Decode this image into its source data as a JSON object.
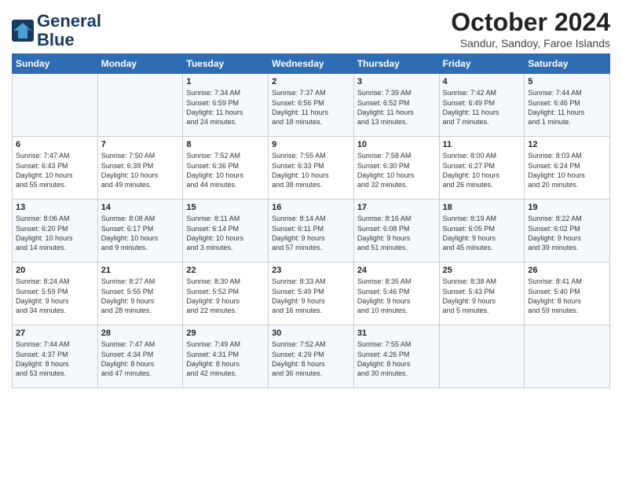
{
  "header": {
    "logo_line1": "General",
    "logo_line2": "Blue",
    "month_title": "October 2024",
    "location": "Sandur, Sandoy, Faroe Islands"
  },
  "weekdays": [
    "Sunday",
    "Monday",
    "Tuesday",
    "Wednesday",
    "Thursday",
    "Friday",
    "Saturday"
  ],
  "weeks": [
    [
      {
        "day": "",
        "text": ""
      },
      {
        "day": "",
        "text": ""
      },
      {
        "day": "1",
        "text": "Sunrise: 7:34 AM\nSunset: 6:59 PM\nDaylight: 11 hours\nand 24 minutes."
      },
      {
        "day": "2",
        "text": "Sunrise: 7:37 AM\nSunset: 6:56 PM\nDaylight: 11 hours\nand 18 minutes."
      },
      {
        "day": "3",
        "text": "Sunrise: 7:39 AM\nSunset: 6:52 PM\nDaylight: 11 hours\nand 13 minutes."
      },
      {
        "day": "4",
        "text": "Sunrise: 7:42 AM\nSunset: 6:49 PM\nDaylight: 11 hours\nand 7 minutes."
      },
      {
        "day": "5",
        "text": "Sunrise: 7:44 AM\nSunset: 6:46 PM\nDaylight: 11 hours\nand 1 minute."
      }
    ],
    [
      {
        "day": "6",
        "text": "Sunrise: 7:47 AM\nSunset: 6:43 PM\nDaylight: 10 hours\nand 55 minutes."
      },
      {
        "day": "7",
        "text": "Sunrise: 7:50 AM\nSunset: 6:39 PM\nDaylight: 10 hours\nand 49 minutes."
      },
      {
        "day": "8",
        "text": "Sunrise: 7:52 AM\nSunset: 6:36 PM\nDaylight: 10 hours\nand 44 minutes."
      },
      {
        "day": "9",
        "text": "Sunrise: 7:55 AM\nSunset: 6:33 PM\nDaylight: 10 hours\nand 38 minutes."
      },
      {
        "day": "10",
        "text": "Sunrise: 7:58 AM\nSunset: 6:30 PM\nDaylight: 10 hours\nand 32 minutes."
      },
      {
        "day": "11",
        "text": "Sunrise: 8:00 AM\nSunset: 6:27 PM\nDaylight: 10 hours\nand 26 minutes."
      },
      {
        "day": "12",
        "text": "Sunrise: 8:03 AM\nSunset: 6:24 PM\nDaylight: 10 hours\nand 20 minutes."
      }
    ],
    [
      {
        "day": "13",
        "text": "Sunrise: 8:06 AM\nSunset: 6:20 PM\nDaylight: 10 hours\nand 14 minutes."
      },
      {
        "day": "14",
        "text": "Sunrise: 8:08 AM\nSunset: 6:17 PM\nDaylight: 10 hours\nand 9 minutes."
      },
      {
        "day": "15",
        "text": "Sunrise: 8:11 AM\nSunset: 6:14 PM\nDaylight: 10 hours\nand 3 minutes."
      },
      {
        "day": "16",
        "text": "Sunrise: 8:14 AM\nSunset: 6:11 PM\nDaylight: 9 hours\nand 57 minutes."
      },
      {
        "day": "17",
        "text": "Sunrise: 8:16 AM\nSunset: 6:08 PM\nDaylight: 9 hours\nand 51 minutes."
      },
      {
        "day": "18",
        "text": "Sunrise: 8:19 AM\nSunset: 6:05 PM\nDaylight: 9 hours\nand 45 minutes."
      },
      {
        "day": "19",
        "text": "Sunrise: 8:22 AM\nSunset: 6:02 PM\nDaylight: 9 hours\nand 39 minutes."
      }
    ],
    [
      {
        "day": "20",
        "text": "Sunrise: 8:24 AM\nSunset: 5:59 PM\nDaylight: 9 hours\nand 34 minutes."
      },
      {
        "day": "21",
        "text": "Sunrise: 8:27 AM\nSunset: 5:55 PM\nDaylight: 9 hours\nand 28 minutes."
      },
      {
        "day": "22",
        "text": "Sunrise: 8:30 AM\nSunset: 5:52 PM\nDaylight: 9 hours\nand 22 minutes."
      },
      {
        "day": "23",
        "text": "Sunrise: 8:33 AM\nSunset: 5:49 PM\nDaylight: 9 hours\nand 16 minutes."
      },
      {
        "day": "24",
        "text": "Sunrise: 8:35 AM\nSunset: 5:46 PM\nDaylight: 9 hours\nand 10 minutes."
      },
      {
        "day": "25",
        "text": "Sunrise: 8:38 AM\nSunset: 5:43 PM\nDaylight: 9 hours\nand 5 minutes."
      },
      {
        "day": "26",
        "text": "Sunrise: 8:41 AM\nSunset: 5:40 PM\nDaylight: 8 hours\nand 59 minutes."
      }
    ],
    [
      {
        "day": "27",
        "text": "Sunrise: 7:44 AM\nSunset: 4:37 PM\nDaylight: 8 hours\nand 53 minutes."
      },
      {
        "day": "28",
        "text": "Sunrise: 7:47 AM\nSunset: 4:34 PM\nDaylight: 8 hours\nand 47 minutes."
      },
      {
        "day": "29",
        "text": "Sunrise: 7:49 AM\nSunset: 4:31 PM\nDaylight: 8 hours\nand 42 minutes."
      },
      {
        "day": "30",
        "text": "Sunrise: 7:52 AM\nSunset: 4:29 PM\nDaylight: 8 hours\nand 36 minutes."
      },
      {
        "day": "31",
        "text": "Sunrise: 7:55 AM\nSunset: 4:26 PM\nDaylight: 8 hours\nand 30 minutes."
      },
      {
        "day": "",
        "text": ""
      },
      {
        "day": "",
        "text": ""
      }
    ]
  ]
}
